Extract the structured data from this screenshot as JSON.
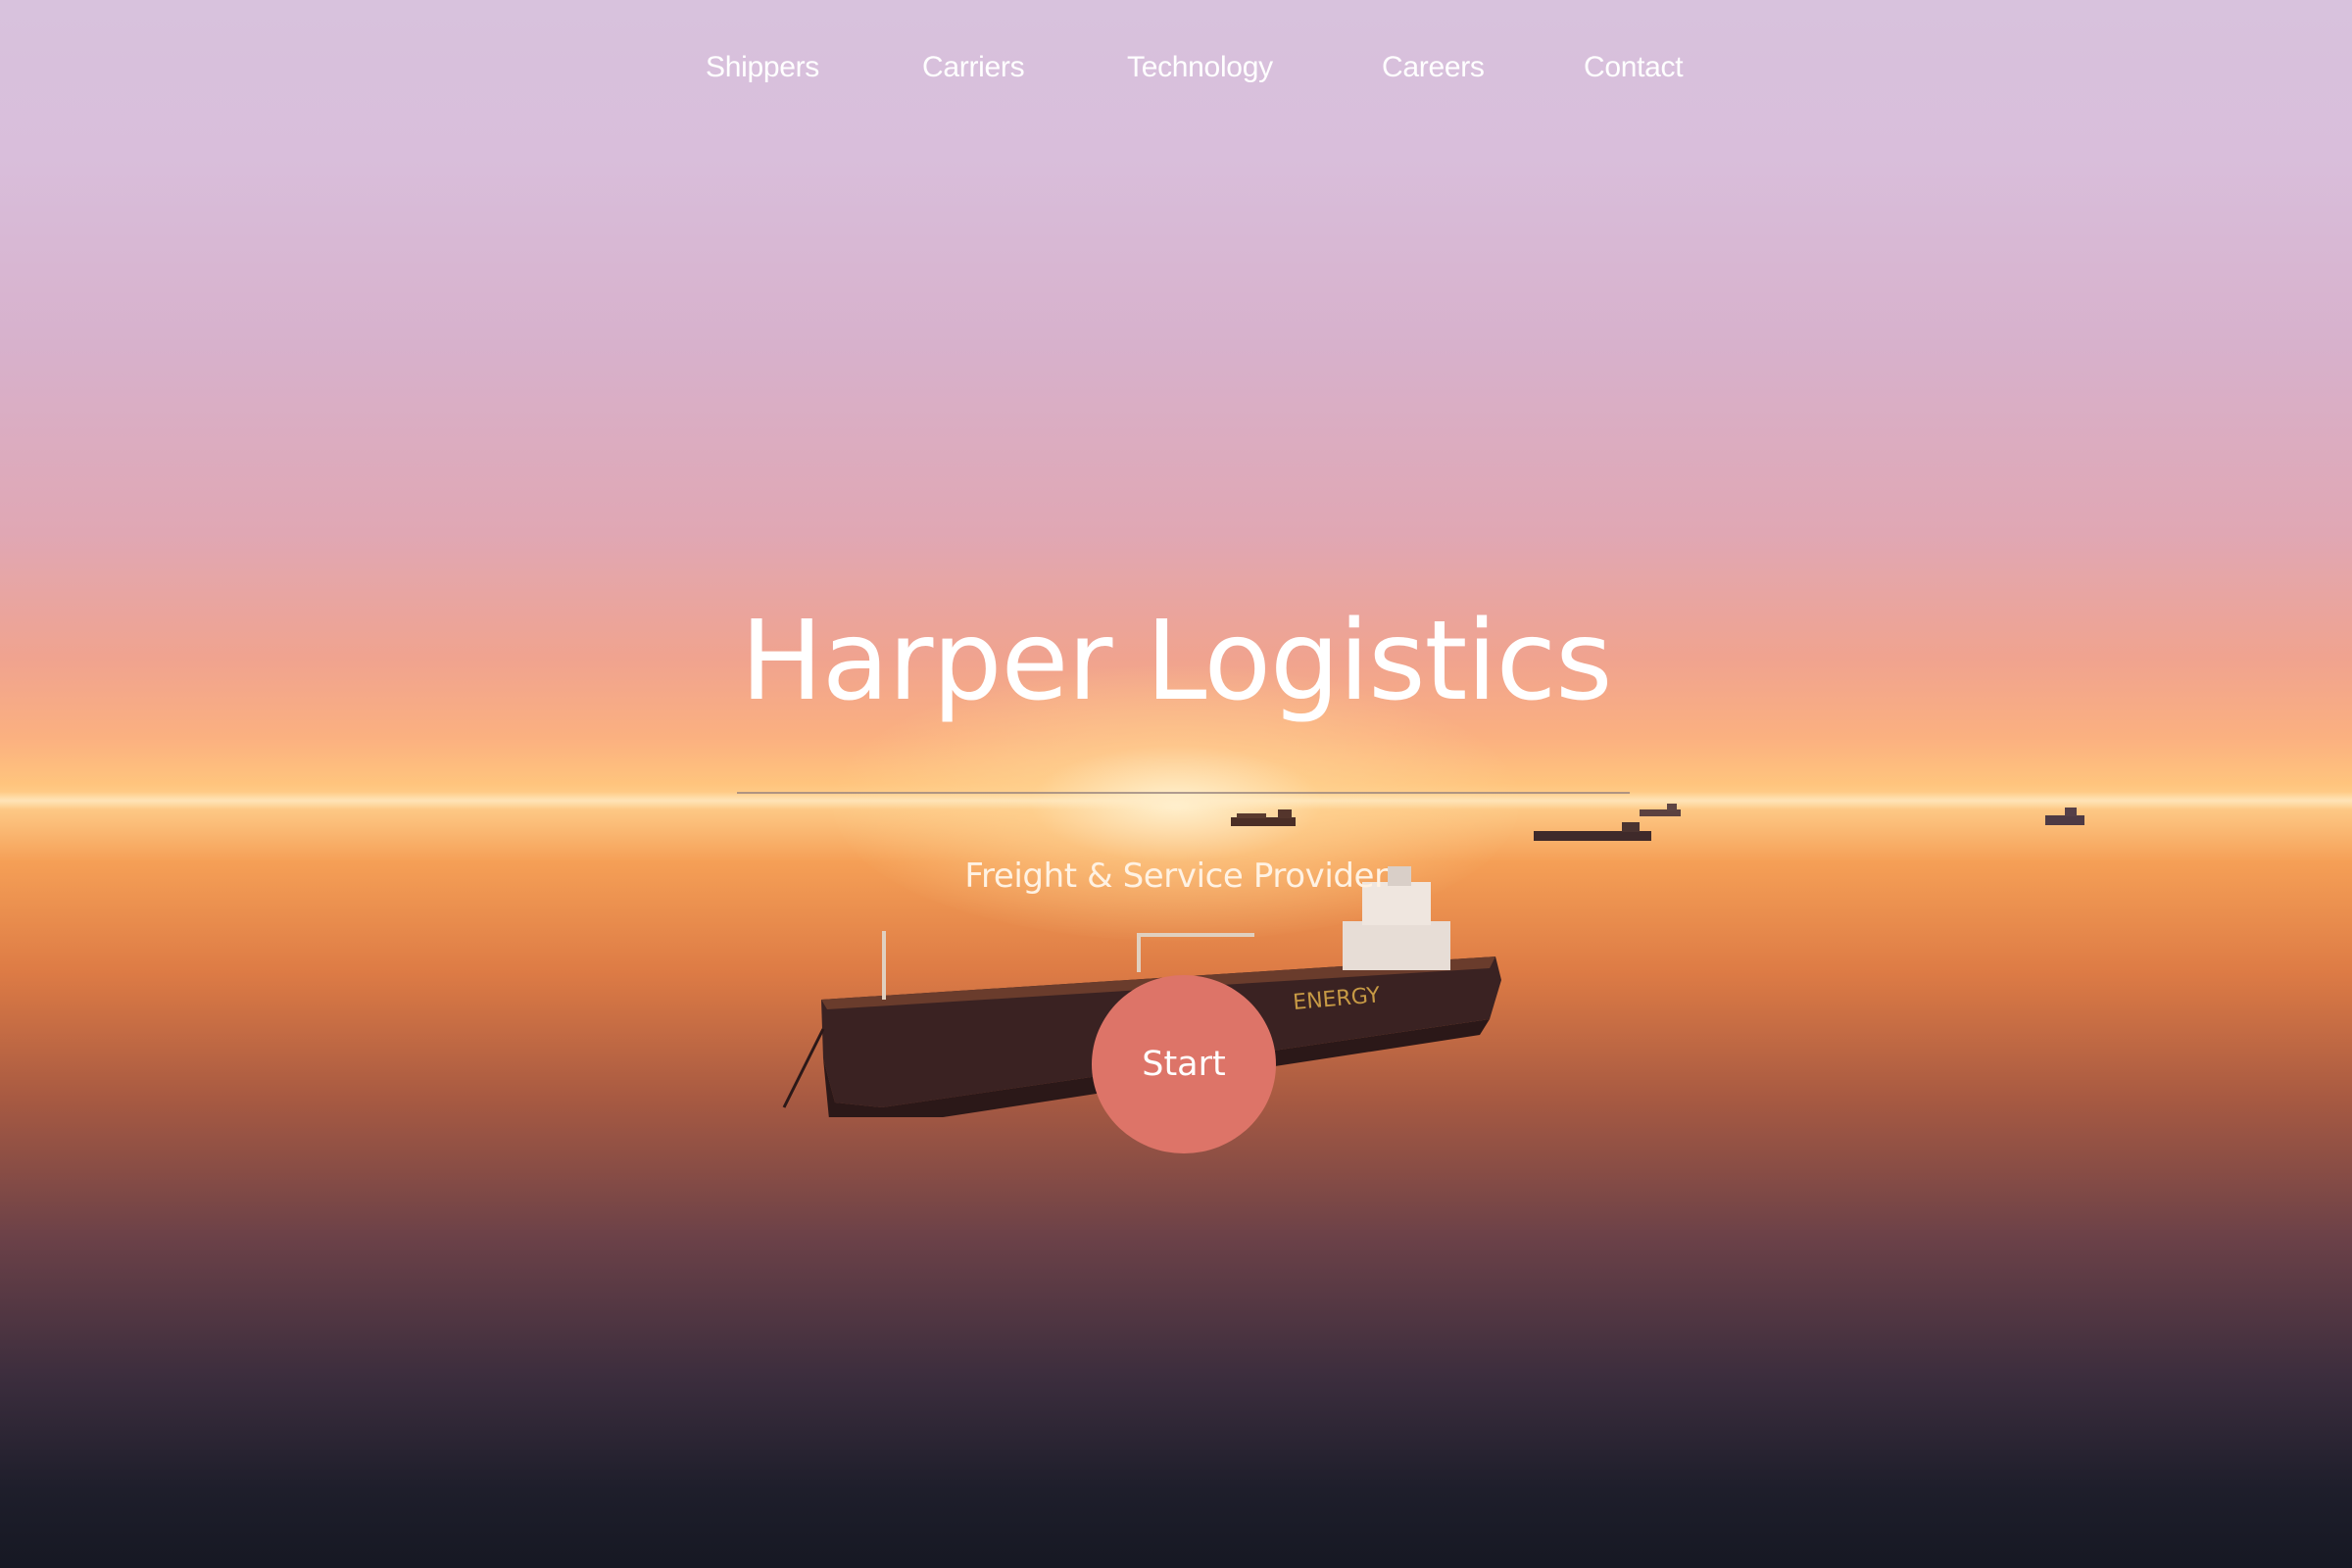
{
  "nav": {
    "items": [
      {
        "label": "Shippers"
      },
      {
        "label": "Carriers"
      },
      {
        "label": "Technology"
      },
      {
        "label": "Careers"
      },
      {
        "label": "Contact"
      }
    ]
  },
  "hero": {
    "title": "Harper Logistics",
    "subtitle": "Freight & Service Provider",
    "start_label": "Start"
  },
  "colors": {
    "button": "#dd7468",
    "text": "#ffffff"
  }
}
